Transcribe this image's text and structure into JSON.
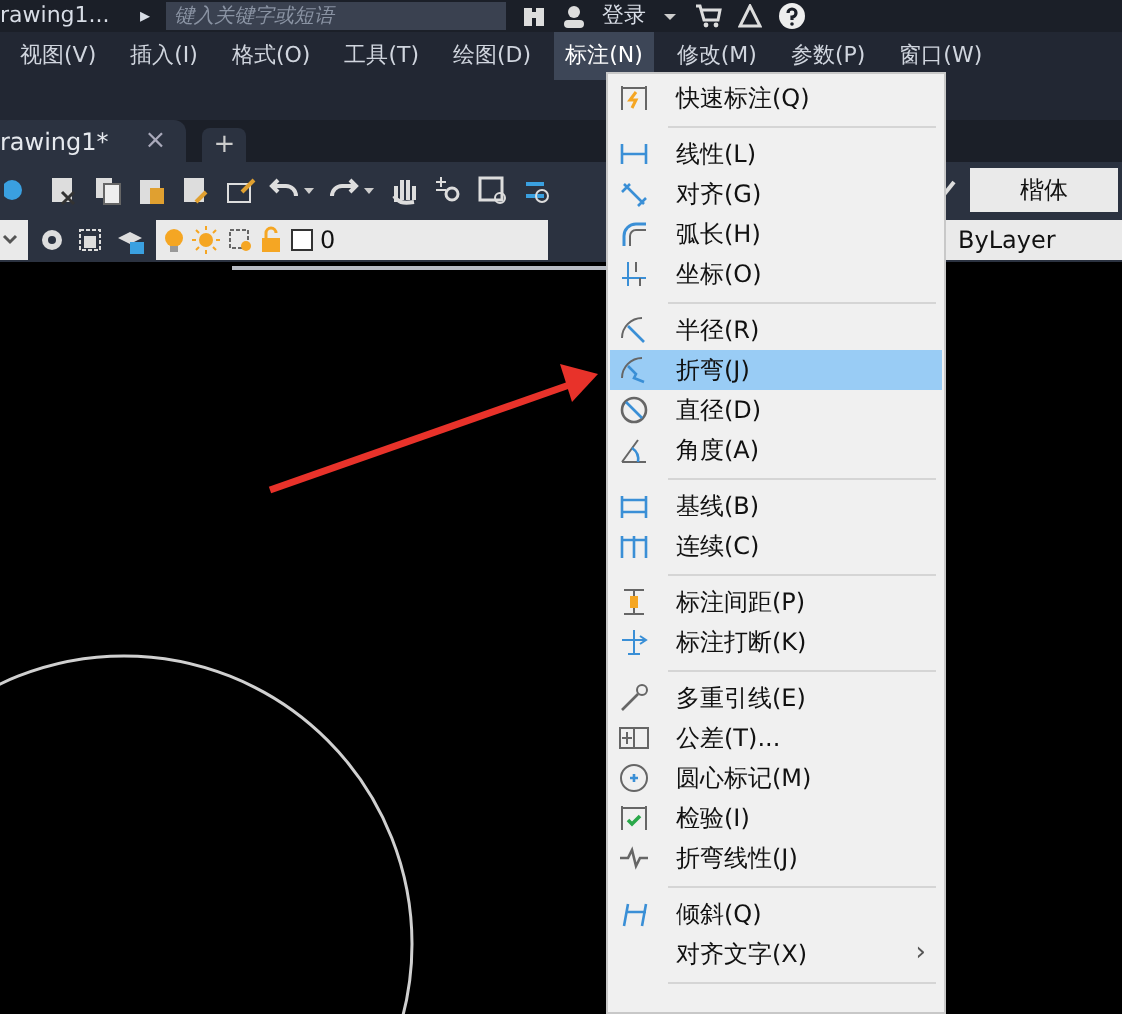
{
  "title_bar": {
    "document": "rawing1...",
    "expand_glyph": "▸",
    "search": {
      "placeholder": "键入关键字或短语"
    },
    "login": "登录"
  },
  "menu_bar": [
    {
      "label": "视图(V)",
      "selected": false
    },
    {
      "label": "插入(I)",
      "selected": false
    },
    {
      "label": "格式(O)",
      "selected": false
    },
    {
      "label": "工具(T)",
      "selected": false
    },
    {
      "label": "绘图(D)",
      "selected": false
    },
    {
      "label": "标注(N)",
      "selected": true
    },
    {
      "label": "修改(M)",
      "selected": false
    },
    {
      "label": "参数(P)",
      "selected": false
    },
    {
      "label": "窗口(W)",
      "selected": false
    }
  ],
  "tabs": [
    {
      "label": "rawing1*",
      "close": "×"
    },
    {
      "label": "+"
    }
  ],
  "toolbar": {
    "text_style": "楷体",
    "layer": "0",
    "linetype": "ByLayer"
  },
  "dimension_menu": [
    {
      "kind": "item",
      "label": "快速标注(Q)",
      "selected": false
    },
    {
      "kind": "separator"
    },
    {
      "kind": "item",
      "label": "线性(L)",
      "selected": false
    },
    {
      "kind": "item",
      "label": "对齐(G)",
      "selected": false
    },
    {
      "kind": "item",
      "label": "弧长(H)",
      "selected": false
    },
    {
      "kind": "item",
      "label": "坐标(O)",
      "selected": false
    },
    {
      "kind": "separator"
    },
    {
      "kind": "item",
      "label": "半径(R)",
      "selected": false
    },
    {
      "kind": "item",
      "label": "折弯(J)",
      "selected": true
    },
    {
      "kind": "item",
      "label": "直径(D)",
      "selected": false
    },
    {
      "kind": "item",
      "label": "角度(A)",
      "selected": false
    },
    {
      "kind": "separator"
    },
    {
      "kind": "item",
      "label": "基线(B)",
      "selected": false
    },
    {
      "kind": "item",
      "label": "连续(C)",
      "selected": false
    },
    {
      "kind": "separator"
    },
    {
      "kind": "item",
      "label": "标注间距(P)",
      "selected": false
    },
    {
      "kind": "item",
      "label": "标注打断(K)",
      "selected": false
    },
    {
      "kind": "separator"
    },
    {
      "kind": "item",
      "label": "多重引线(E)",
      "selected": false
    },
    {
      "kind": "item",
      "label": "公差(T)...",
      "selected": false
    },
    {
      "kind": "item",
      "label": "圆心标记(M)",
      "selected": false
    },
    {
      "kind": "item",
      "label": "检验(I)",
      "selected": false
    },
    {
      "kind": "item",
      "label": "折弯线性(J)",
      "selected": false
    },
    {
      "kind": "separator"
    },
    {
      "kind": "item",
      "label": "倾斜(Q)",
      "selected": false
    },
    {
      "kind": "item",
      "label": "对齐文字(X)",
      "selected": false,
      "submenu": "›"
    },
    {
      "kind": "separator"
    }
  ]
}
